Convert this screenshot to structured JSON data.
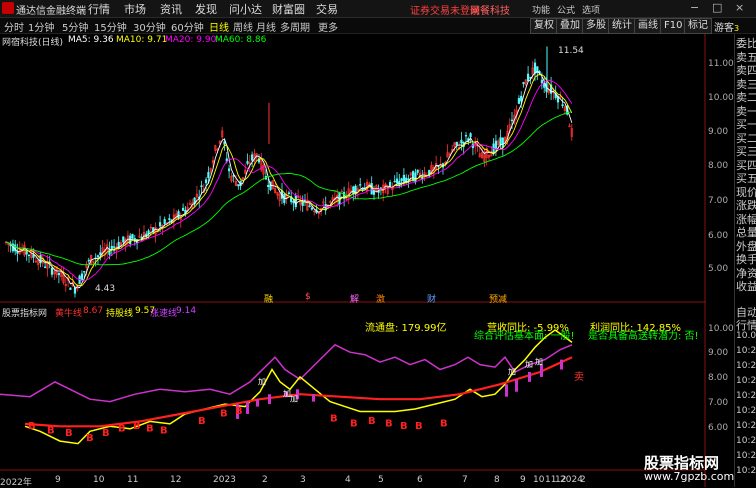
{
  "app": {
    "title": "通达信金融终端"
  },
  "menu": [
    {
      "label": "行情"
    },
    {
      "label": "市场"
    },
    {
      "label": "资讯"
    },
    {
      "label": "发现"
    },
    {
      "label": "问小达"
    },
    {
      "label": "财富圈"
    },
    {
      "label": "交易"
    }
  ],
  "warning": "证券交易未登录",
  "broker": "网餐科技",
  "window_controls": {
    "min": "−",
    "max": "□",
    "close": "×"
  },
  "periods": [
    {
      "label": "分时",
      "active": false
    },
    {
      "label": "1分钟",
      "active": false
    },
    {
      "label": "5分钟",
      "active": false
    },
    {
      "label": "15分钟",
      "active": false
    },
    {
      "label": "30分钟",
      "active": false
    },
    {
      "label": "60分钟",
      "active": false
    },
    {
      "label": "日线",
      "active": true
    },
    {
      "label": "周线",
      "active": false
    },
    {
      "label": "月线",
      "active": false
    },
    {
      "label": "多周期",
      "active": false
    },
    {
      "label": "更多",
      "active": false
    }
  ],
  "tools": [
    {
      "label": "复权"
    },
    {
      "label": "叠加"
    },
    {
      "label": "多股"
    },
    {
      "label": "统计"
    },
    {
      "label": "画线"
    },
    {
      "label": "F10"
    },
    {
      "label": "标记"
    }
  ],
  "top_right": [
    {
      "label": "功能"
    },
    {
      "label": "公式"
    },
    {
      "label": "选项"
    }
  ],
  "user": "游客",
  "main_legend": {
    "stock": "网宿科技(日线)",
    "ma5": "MA5: 9.36",
    "ma10": "MA10: 9.71",
    "ma20": "MA20: 9.90",
    "ma60": "MA60: 8.86"
  },
  "main_axis": [
    "11.00",
    "10.00",
    "9.00",
    "8.00",
    "7.00",
    "6.00",
    "5.00"
  ],
  "annotations": {
    "high": "11.54",
    "low": "4.43"
  },
  "event_marks": [
    {
      "label": "融",
      "color": "#ffd700"
    },
    {
      "label": "$",
      "color": "#ff5050"
    },
    {
      "label": "解",
      "color": "#ff66ff"
    },
    {
      "label": "激",
      "color": "#ff8800"
    },
    {
      "label": "财",
      "color": "#5aa0ff"
    },
    {
      "label": "预减",
      "color": "#ffaa00"
    }
  ],
  "indicator": {
    "name": "股票指标网",
    "l1_label": "黄牛线",
    "l1_value": "8.67",
    "l2_label": "持股线",
    "l2_value": "9.57",
    "l3_label": "涨速线",
    "l3_value": "9.14",
    "float_cap": "流通盘: 179.99亿",
    "revenue": "营收同比: -5.99%",
    "profit": "利润同比: 142.85%",
    "text1": "综合评估基本面: 一般!",
    "text2": "是否具备高送转潜力: 否!",
    "sell_mark": "卖",
    "buy_mark": "B",
    "add_mark": "加"
  },
  "ind_axis": [
    "10.00",
    "9.00",
    "8.00",
    "7.00",
    "6.00"
  ],
  "date_axis": [
    "2022年",
    "9",
    "10",
    "11",
    "12",
    "2023",
    "2",
    "3",
    "4",
    "5",
    "6",
    "7",
    "8",
    "9",
    "10",
    "11",
    "12",
    "2024",
    "2",
    "3"
  ],
  "right_panel": {
    "items": [
      "委比",
      "卖五",
      "卖四",
      "卖三",
      "卖二",
      "卖一",
      "买一",
      "买二",
      "买三",
      "买四",
      "买五",
      "现价",
      "涨跌",
      "涨幅",
      "总量",
      "外盘",
      "换手",
      "净资",
      "收益"
    ],
    "bottom": [
      "自动",
      "行情"
    ],
    "values": [
      "10.00",
      "10:27",
      "10:27",
      "10:27",
      "10:27",
      "10:27",
      "10:27",
      "10:27",
      "10:27",
      "10:27"
    ],
    "top_value": "3"
  },
  "watermark": {
    "title": "股票指标网",
    "url": "www.7gpzb.com"
  },
  "colors": {
    "k_up": "#ff3232",
    "k_down": "#54fcfc",
    "ma5": "#ffffff",
    "ma10": "#ffff00",
    "ma20": "#ff00ff",
    "ma60": "#00ff00",
    "yellow": "#ffff00",
    "red": "#ff2020",
    "magenta": "#cc33cc"
  }
}
